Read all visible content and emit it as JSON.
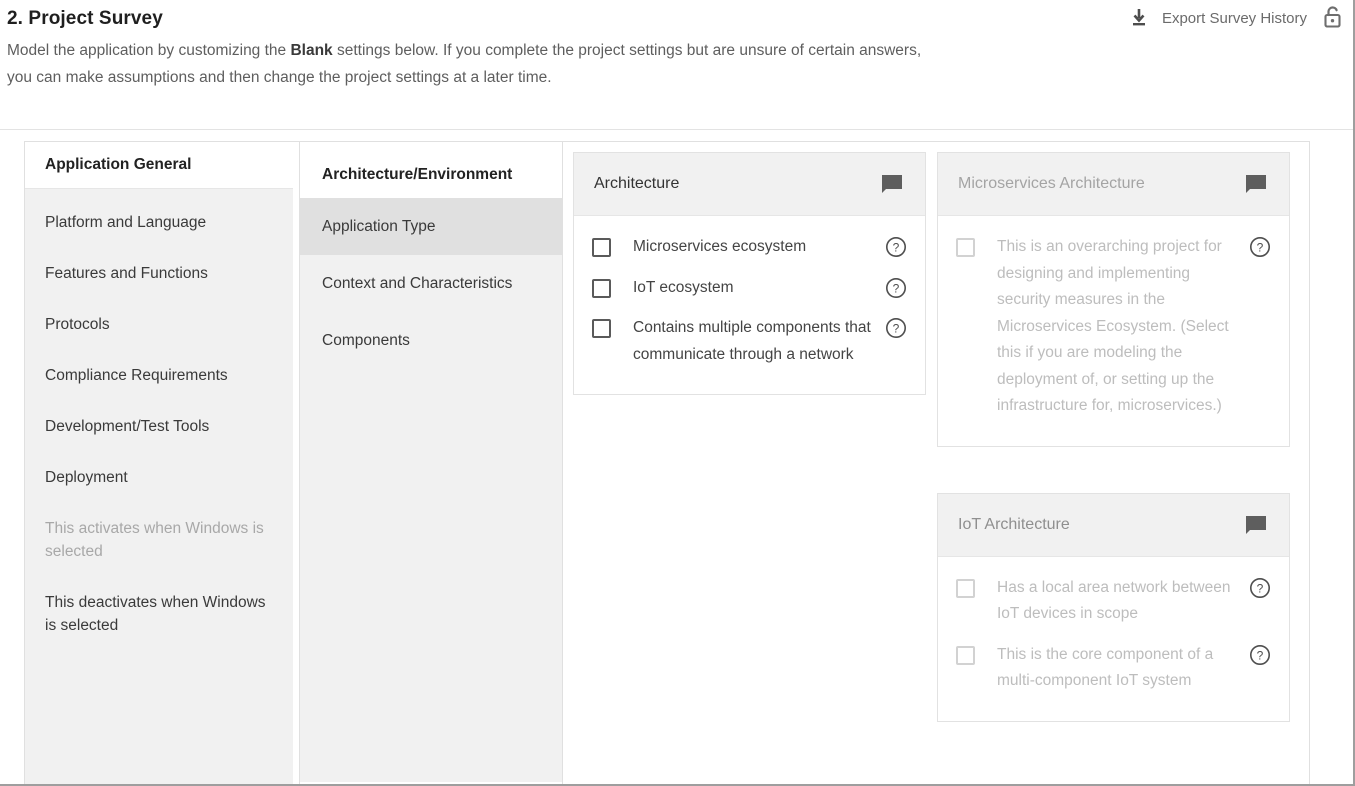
{
  "header": {
    "title": "2. Project Survey",
    "description_part1": "Model the application by customizing the ",
    "description_bold": "Blank",
    "description_part2": " settings below. If you complete the project settings but are unsure of certain answers, you can make assumptions and then change the project settings at a later time.",
    "export_label": "Export Survey History",
    "export_icon": "download-icon",
    "lock_icon": "unlock-icon"
  },
  "sidebar": {
    "header": "Application General",
    "items": [
      {
        "label": "Platform and Language",
        "disabled": false
      },
      {
        "label": "Features and Functions",
        "disabled": false
      },
      {
        "label": "Protocols",
        "disabled": false
      },
      {
        "label": "Compliance Requirements",
        "disabled": false
      },
      {
        "label": "Development/Test Tools",
        "disabled": false
      },
      {
        "label": "Deployment",
        "disabled": false
      },
      {
        "label": "This activates when Windows is selected",
        "disabled": true
      },
      {
        "label": "This deactivates when Windows is selected",
        "disabled": false
      }
    ]
  },
  "subnav": {
    "header": "Architecture/Environment",
    "items": [
      {
        "label": "Application Type",
        "active": true
      },
      {
        "label": "Context and Characteristics",
        "active": false
      },
      {
        "label": "Components",
        "active": false
      }
    ]
  },
  "cards": {
    "column_left": [
      {
        "title": "Architecture",
        "dim": false,
        "comment_icon": "comment-icon",
        "options": [
          {
            "label": "Microservices ecosystem",
            "checked": false,
            "dim": false,
            "help_icon": "help-circle-icon"
          },
          {
            "label": "IoT ecosystem",
            "checked": false,
            "dim": false,
            "help_icon": "help-circle-icon"
          },
          {
            "label": "Contains multiple components that communicate through a network",
            "checked": false,
            "dim": false,
            "help_icon": "help-circle-icon"
          }
        ]
      }
    ],
    "column_right": [
      {
        "title": "Microservices Architecture",
        "dim": true,
        "comment_icon": "comment-icon",
        "options": [
          {
            "label": "This is an overarching project for designing and implementing security measures in the Microservices Ecosystem. (Select this if you are modeling the deployment of, or setting up the infrastructure for, microservices.)",
            "checked": false,
            "dim": true,
            "help_icon": "help-circle-icon"
          }
        ]
      },
      {
        "title": "IoT Architecture",
        "dim": true,
        "comment_icon": "comment-icon",
        "options": [
          {
            "label": "Has a local area network between IoT devices in scope",
            "checked": false,
            "dim": true,
            "help_icon": "help-circle-icon"
          },
          {
            "label": "This is the core component of a multi-component IoT system",
            "checked": false,
            "dim": true,
            "help_icon": "help-circle-icon"
          }
        ]
      }
    ]
  },
  "colors": {
    "panel_bg": "#f1f1f1",
    "active_row": "#e0e0e0",
    "border": "#e2e2e2",
    "text": "#444444",
    "text_dim": "#bdbdbd",
    "icon_dark": "#5e5e5e"
  }
}
